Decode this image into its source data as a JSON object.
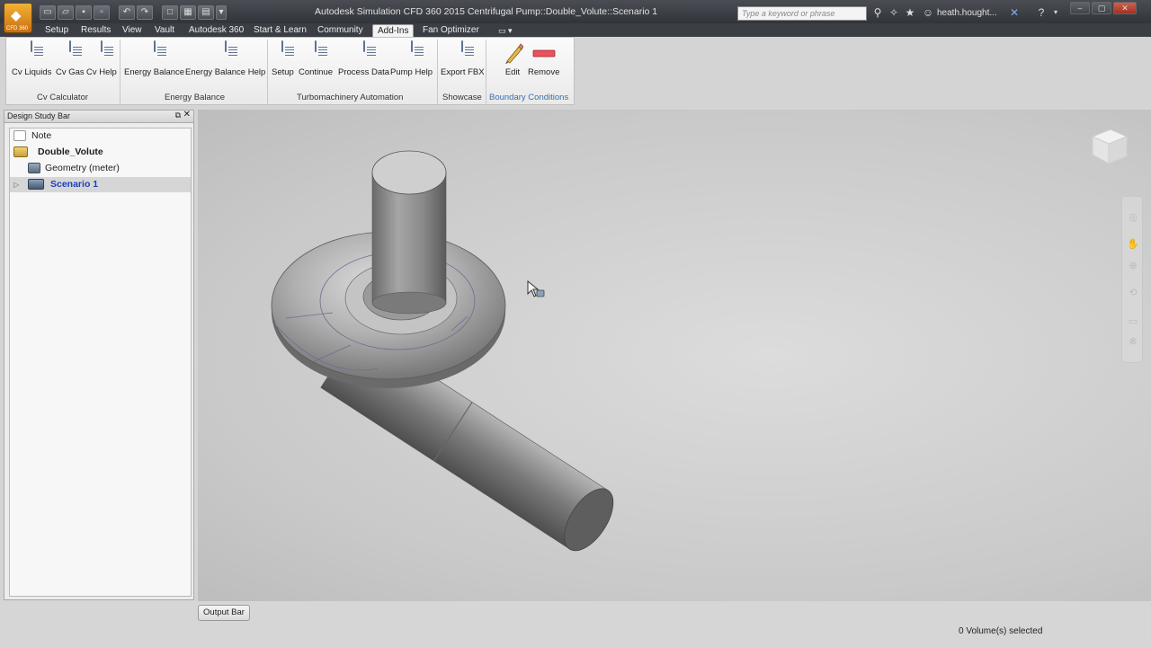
{
  "app": {
    "logo_label": "CFD 360",
    "window_title": "Autodesk Simulation CFD 360 2015   Centrifugal Pump::Double_Volute::Scenario 1",
    "search_placeholder": "Type a keyword or phrase",
    "user_name": "heath.hought..."
  },
  "tabs": [
    {
      "label": "Setup",
      "active": false
    },
    {
      "label": "Results",
      "active": false
    },
    {
      "label": "View",
      "active": false
    },
    {
      "label": "Vault",
      "active": false
    },
    {
      "label": "Autodesk 360",
      "active": false
    },
    {
      "label": "Start & Learn",
      "active": false
    },
    {
      "label": "Community",
      "active": false
    },
    {
      "label": "Add-Ins",
      "active": true
    },
    {
      "label": "Fan Optimizer",
      "active": false
    }
  ],
  "ribbon": {
    "buttons": [
      {
        "label": "Cv Liquids"
      },
      {
        "label": "Cv Gas"
      },
      {
        "label": "Cv Help"
      },
      {
        "label": "Energy Balance"
      },
      {
        "label": "Energy Balance Help"
      },
      {
        "label": "Setup"
      },
      {
        "label": "Continue"
      },
      {
        "label": "Process Data"
      },
      {
        "label": "Pump Help"
      },
      {
        "label": "Export FBX"
      },
      {
        "label": "Edit"
      },
      {
        "label": "Remove"
      }
    ],
    "groups": [
      {
        "label": "Cv Calculator"
      },
      {
        "label": "Energy Balance"
      },
      {
        "label": "Turbomachinery Automation"
      },
      {
        "label": "Showcase"
      },
      {
        "label": "Boundary Conditions"
      }
    ]
  },
  "design_study_bar": {
    "title": "Design Study Bar",
    "items": [
      {
        "label": "Note"
      },
      {
        "label": "Double_Volute"
      },
      {
        "label": "Geometry (meter)"
      },
      {
        "label": "Scenario 1"
      }
    ]
  },
  "bottom": {
    "output_bar_label": "Output Bar",
    "status_text": "0 Volume(s) selected"
  },
  "colors": {
    "accent": "#3a6ea8",
    "selected_item": "#1a3fbf",
    "titlebar": "#3b3f45"
  }
}
